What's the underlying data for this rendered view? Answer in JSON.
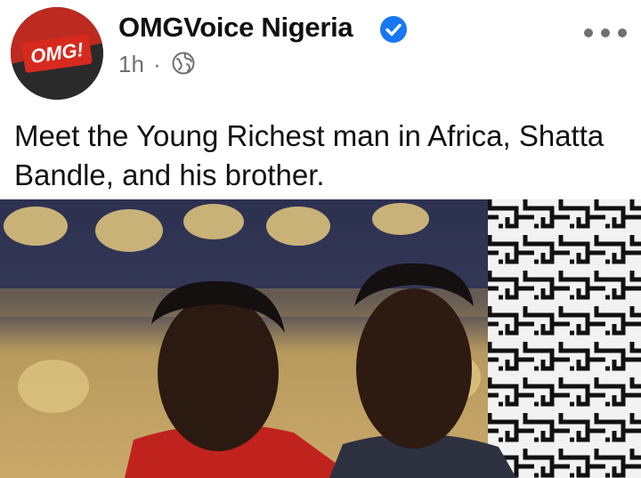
{
  "post": {
    "page_name": "OMGVoice Nigeria",
    "avatar_text": "OMG!",
    "timestamp": "1h",
    "separator": "·",
    "privacy_icon": "globe-icon",
    "verified_icon": "verified-badge-icon",
    "caption": "Meet the Young Richest man in Africa, Shatta Bandle, and his brother."
  },
  "colors": {
    "verified": "#1877f2",
    "brand_red": "#d62a1e",
    "meta_text": "#707070"
  }
}
